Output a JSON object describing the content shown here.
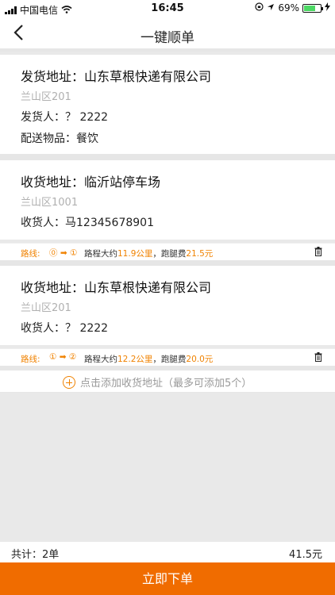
{
  "status": {
    "carrier": "中国电信",
    "time": "16:45",
    "battery": "69%",
    "battery_fraction": 0.69
  },
  "nav": {
    "title": "一键顺单"
  },
  "sender": {
    "address_label": "发货地址：山东草根快递有限公司",
    "detail": "兰山区201",
    "person": "发货人：？ 2222",
    "goods": "配送物品：餐饮"
  },
  "receivers": [
    {
      "address_label": "收货地址：临沂站停车场",
      "detail": "兰山区1001",
      "person": "收货人：马12345678901",
      "route": {
        "label": "路线:",
        "seq": "⓪ ➡ ①",
        "distance_prefix": "路程大约",
        "distance": "11.9公里",
        "fee_prefix": "，跑腿费",
        "fee": "21.5元"
      }
    },
    {
      "address_label": "收货地址：山东草根快递有限公司",
      "detail": "兰山区201",
      "person": "收货人：？ 2222",
      "route": {
        "label": "路线:",
        "seq": "① ➡ ②",
        "distance_prefix": "路程大约",
        "distance": "12.2公里",
        "fee_prefix": "，跑腿费",
        "fee": "20.0元"
      }
    }
  ],
  "add_address": {
    "label": "点击添加收货地址（最多可添加5个）"
  },
  "footer": {
    "total": "共计：2单",
    "price": "41.5元",
    "submit": "立即下单"
  }
}
